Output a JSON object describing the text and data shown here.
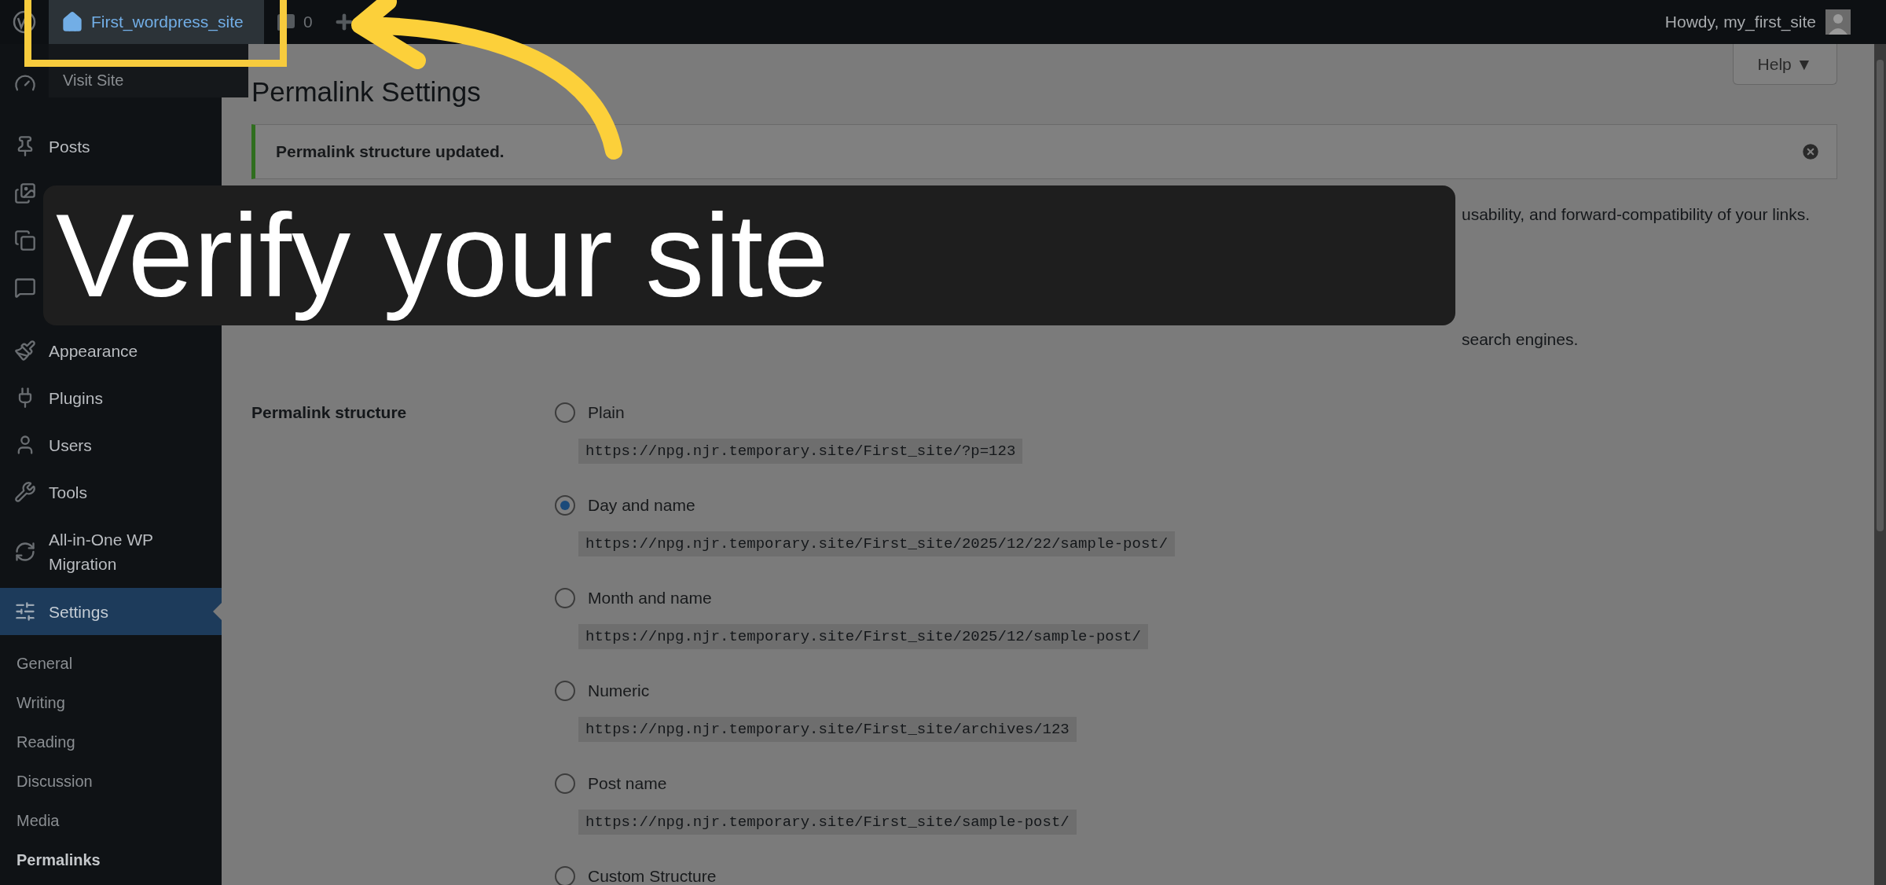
{
  "admin_bar": {
    "site_name": "First_wordpress_site",
    "site_menu": {
      "expanded": true,
      "items": [
        "Visit Site"
      ]
    },
    "comments_count": "0",
    "greeting": "Howdy, my_first_site"
  },
  "sidebar": {
    "items": [
      {
        "label": "Posts",
        "selected": false
      },
      {
        "selected": false
      },
      {
        "selected": false
      },
      {
        "selected": false
      },
      {
        "label": "Appearance",
        "selected": false
      },
      {
        "label": "Plugins",
        "selected": false
      },
      {
        "label": "Users",
        "selected": false
      },
      {
        "label": "Tools",
        "selected": false
      },
      {
        "label": "All-in-One WP Migration",
        "selected": false
      },
      {
        "label": "Settings",
        "selected": true
      }
    ],
    "submenu": [
      {
        "label": "General",
        "selected": false
      },
      {
        "label": "Writing",
        "selected": false
      },
      {
        "label": "Reading",
        "selected": false
      },
      {
        "label": "Discussion",
        "selected": false
      },
      {
        "label": "Media",
        "selected": false
      },
      {
        "label": "Permalinks",
        "selected": true
      }
    ]
  },
  "help_button": "Help ▼",
  "page_title": "Permalink Settings",
  "notice": {
    "text": "Permalink structure updated.",
    "kind": "success"
  },
  "intro": {
    "visible_text": "usability, and forward-compatibility of your links."
  },
  "common_settings": {
    "visible_text": "search engines."
  },
  "permalink_structure": {
    "label": "Permalink structure",
    "options": [
      {
        "label": "Plain",
        "example": "https://npg.njr.temporary.site/First_site/?p=123",
        "selected": false
      },
      {
        "label": "Day and name",
        "example": "https://npg.njr.temporary.site/First_site/2025/12/22/sample-post/",
        "selected": true
      },
      {
        "label": "Month and name",
        "example": "https://npg.njr.temporary.site/First_site/2025/12/sample-post/",
        "selected": false
      },
      {
        "label": "Numeric",
        "example": "https://npg.njr.temporary.site/First_site/archives/123",
        "selected": false
      },
      {
        "label": "Post name",
        "example": "https://npg.njr.temporary.site/First_site/sample-post/",
        "selected": false
      },
      {
        "label": "Custom Structure",
        "selected": false
      }
    ]
  },
  "tutorial": {
    "caption": "Verify your site"
  }
}
